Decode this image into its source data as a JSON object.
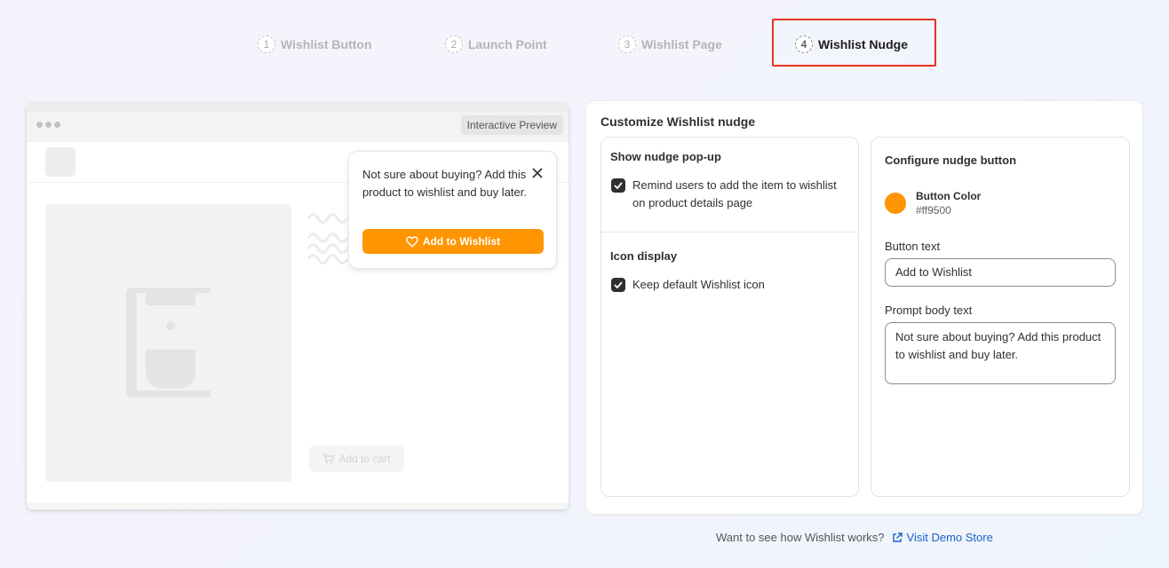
{
  "stepper": {
    "steps": [
      {
        "number": "1",
        "label": "Wishlist Button",
        "active": false
      },
      {
        "number": "2",
        "label": "Launch Point",
        "active": false
      },
      {
        "number": "3",
        "label": "Wishlist Page",
        "active": false
      },
      {
        "number": "4",
        "label": "Wishlist Nudge",
        "active": true
      }
    ]
  },
  "preview": {
    "badge": "Interactive Preview",
    "add_to_cart": "Add to cart",
    "nudge": {
      "text": "Not sure about buying? Add this product to wishlist and buy later.",
      "button": "Add to Wishlist"
    }
  },
  "panel": {
    "title": "Customize Wishlist nudge",
    "show_nudge": {
      "title": "Show nudge pop-up",
      "checkbox_label": "Remind users to add the item to wishlist on product details page",
      "checked": true
    },
    "icon_display": {
      "title": "Icon display",
      "checkbox_label": "Keep default Wishlist icon",
      "checked": true
    },
    "configure": {
      "title": "Configure nudge button",
      "color_label": "Button Color",
      "color_value": "#ff9500",
      "button_text_label": "Button text",
      "button_text_value": "Add to Wishlist",
      "prompt_label": "Prompt body text",
      "prompt_value": "Not sure about buying? Add this product to wishlist and buy later."
    }
  },
  "footer": {
    "question": "Want to see how Wishlist works?",
    "link": "Visit Demo Store"
  },
  "colors": {
    "accent": "#ff9500",
    "highlight": "#e8321e",
    "link": "#1a62cc"
  }
}
